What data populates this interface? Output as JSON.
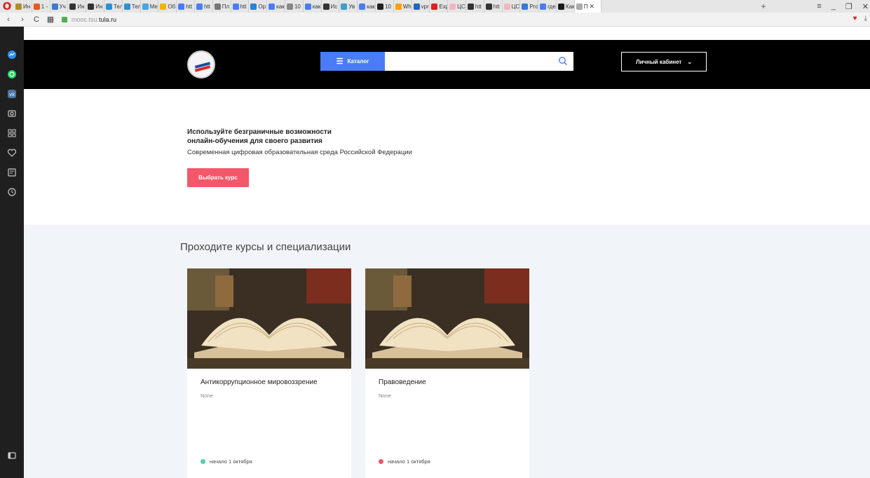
{
  "browser": {
    "tabs": [
      "Ин",
      "1 -",
      "Уч",
      "Ин",
      "Ин",
      "Тел",
      "Тел",
      "Ме",
      "Об",
      "htt",
      "htt",
      "Пл",
      "htt",
      "Ор",
      "как",
      "10",
      "как",
      "Ис",
      "Ув",
      "как",
      "10",
      "Wh",
      "vpr",
      "Exp",
      "ЦС",
      "htt",
      "htt",
      "ЦС",
      "Pro",
      "где",
      "Как",
      "П"
    ],
    "tab_colors": [
      "#b88a2a",
      "#e25b1f",
      "#3d7bd0",
      "#333333",
      "#333333",
      "#2f8fd0",
      "#2f8fd0",
      "#4aa3df",
      "#f0b400",
      "#4a7df5",
      "#4a7df5",
      "#777777",
      "#4a7df5",
      "#2d7fd8",
      "#4a7df5",
      "#888888",
      "#4a7df5",
      "#333333",
      "#3aa0c8",
      "#4a7df5",
      "#222222",
      "#ffa000",
      "#2a62b6",
      "#e0201f",
      "#f2b6c0",
      "#333333",
      "#333333",
      "#f2b6c0",
      "#3a78d0",
      "#4a7df5",
      "#1a1a1a",
      "#aaaaaa"
    ],
    "url_grey": "mooc.tsu.",
    "url_dark": "tula.ru"
  },
  "sidebar_icons": [
    "messenger-icon",
    "whatsapp-icon",
    "vk-icon",
    "camera-icon",
    "grid-icon",
    "heart-icon",
    "news-icon",
    "history-icon",
    "sidebar-toggle-icon"
  ],
  "header": {
    "catalog_label": "Каталог",
    "search_placeholder": "",
    "cabinet_label": "Личный кабинет"
  },
  "hero": {
    "title_line1": "Используйте безграничные возможности",
    "title_line2": "онлайн-обучения для своего развития",
    "subtitle": "Современная цифровая образовательная среда Российской Федерации",
    "button_label": "Выбрать курс"
  },
  "courses": {
    "heading": "Проходите курсы и специализации",
    "items": [
      {
        "title": "Антикоррупционное мировоззрение",
        "description": "None",
        "start": "начало 1 октября",
        "status_color": "#4fd1b5"
      },
      {
        "title": "Правоведение",
        "description": "None",
        "start": "начало 1 октября",
        "status_color": "#f2576a"
      }
    ]
  }
}
